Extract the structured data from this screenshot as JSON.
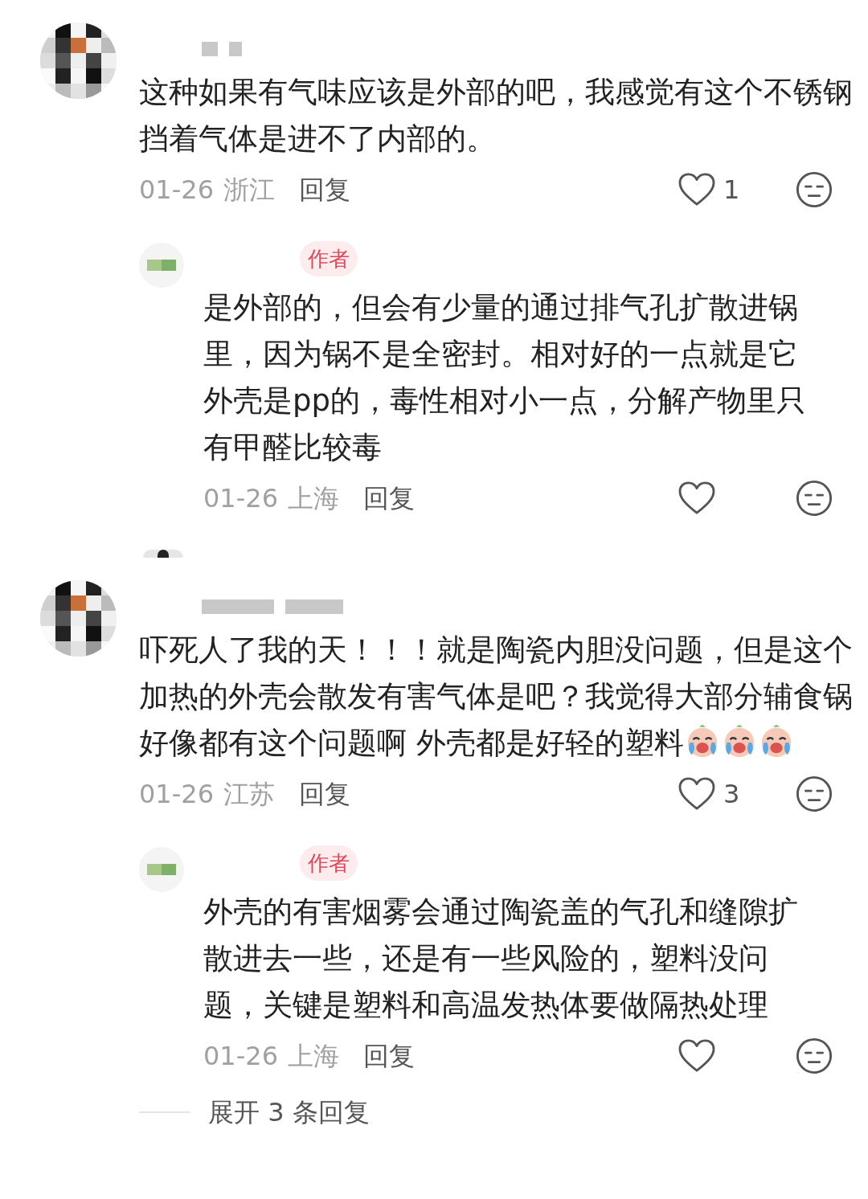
{
  "comments": [
    {
      "text": "这种如果有气味应该是外部的吧，我感觉有这个不锈钢挡着气体是进不了内部的。",
      "date": "01-26",
      "location": "浙江",
      "reply_label": "回复",
      "likes": "1",
      "replies": [
        {
          "badge": "作者",
          "text": "是外部的，但会有少量的通过排气孔扩散进锅里，因为锅不是全密封。相对好的一点就是它外壳是pp的，毒性相对小一点，分解产物里只有甲醛比较毒",
          "date": "01-26",
          "location": "上海",
          "reply_label": "回复"
        }
      ]
    },
    {
      "text": "吓死人了我的天！！！就是陶瓷内胆没问题，但是这个加热的外壳会散发有害气体是吧？我觉得大部分辅食锅好像都有这个问题啊 外壳都是好轻的塑料",
      "emojis": [
        {
          "kind": "crying"
        },
        {
          "kind": "crying"
        },
        {
          "kind": "crying"
        }
      ],
      "date": "01-26",
      "location": "江苏",
      "reply_label": "回复",
      "likes": "3",
      "replies": [
        {
          "badge": "作者",
          "text": "外壳的有害烟雾会通过陶瓷盖的气孔和缝隙扩散进去一些，还是有一些风险的，塑料没问题，关键是塑料和高温发热体要做隔热处理",
          "date": "01-26",
          "location": "上海",
          "reply_label": "回复"
        }
      ]
    }
  ],
  "expand_replies": "展开 3 条回复"
}
